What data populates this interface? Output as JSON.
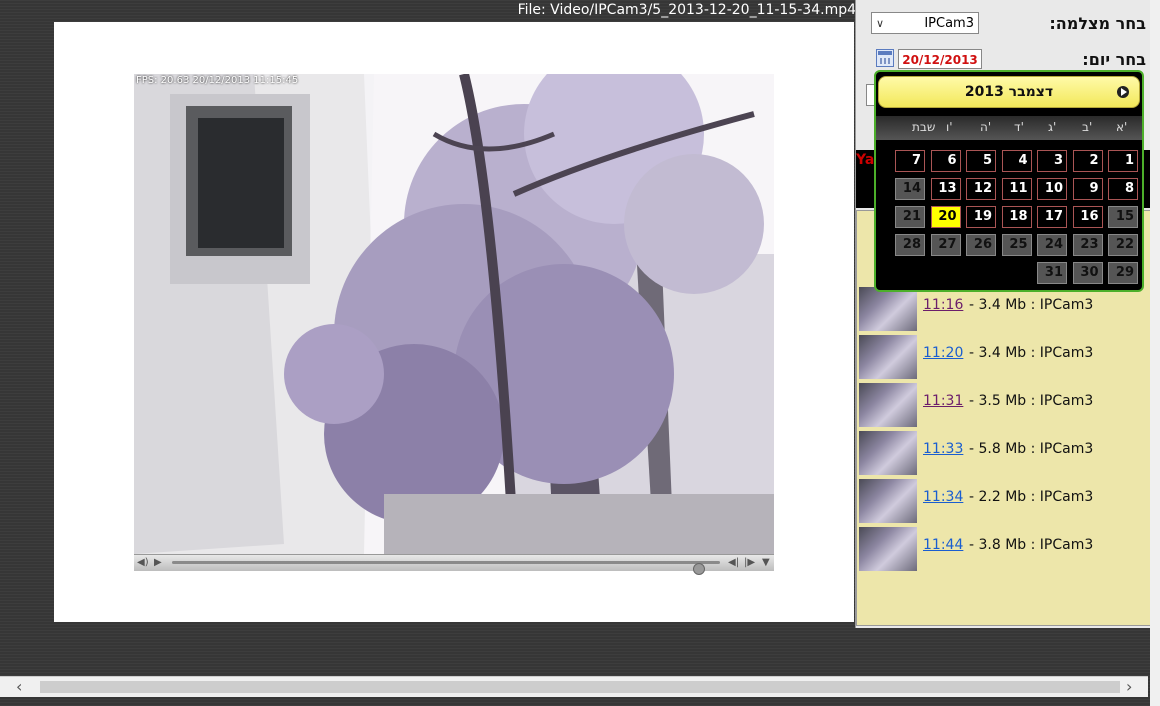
{
  "file_title": "File: Video/IPCam3/5_2013-12-20_11-15-34.mp4",
  "video": {
    "fps_overlay": "FPS: 20.63 20/12/2013 11:15:45",
    "progress": 0.96
  },
  "right_panel": {
    "camera_label": "בחר מצלמה:",
    "camera_value": "IPCam3",
    "date_label": "בחר יום:",
    "date_value": "20/12/2013",
    "side_red_text": "Yai"
  },
  "calendar": {
    "month_title": "דצמבר 2013",
    "weekdays": [
      "א'",
      "ב'",
      "ג'",
      "ד'",
      "ה'",
      "ו'",
      "שבת"
    ],
    "weeks": [
      [
        {
          "d": "1",
          "t": "cur"
        },
        {
          "d": "2",
          "t": "cur"
        },
        {
          "d": "3",
          "t": "cur"
        },
        {
          "d": "4",
          "t": "cur"
        },
        {
          "d": "5",
          "t": "cur"
        },
        {
          "d": "6",
          "t": "cur"
        },
        {
          "d": "7",
          "t": "cur"
        }
      ],
      [
        {
          "d": "8",
          "t": "cur"
        },
        {
          "d": "9",
          "t": "cur"
        },
        {
          "d": "10",
          "t": "cur"
        },
        {
          "d": "11",
          "t": "cur"
        },
        {
          "d": "12",
          "t": "cur"
        },
        {
          "d": "13",
          "t": "cur"
        },
        {
          "d": "14",
          "t": "wknd"
        }
      ],
      [
        {
          "d": "15",
          "t": "wknd"
        },
        {
          "d": "16",
          "t": "cur"
        },
        {
          "d": "17",
          "t": "cur"
        },
        {
          "d": "18",
          "t": "cur"
        },
        {
          "d": "19",
          "t": "cur"
        },
        {
          "d": "20",
          "t": "sel"
        },
        {
          "d": "21",
          "t": "wknd"
        }
      ],
      [
        {
          "d": "22",
          "t": "wknd"
        },
        {
          "d": "23",
          "t": "wknd"
        },
        {
          "d": "24",
          "t": "wknd"
        },
        {
          "d": "25",
          "t": "wknd"
        },
        {
          "d": "26",
          "t": "wknd"
        },
        {
          "d": "27",
          "t": "wknd"
        },
        {
          "d": "28",
          "t": "wknd"
        }
      ],
      [
        {
          "d": "29",
          "t": "wknd"
        },
        {
          "d": "30",
          "t": "wknd"
        },
        {
          "d": "31",
          "t": "wknd"
        }
      ]
    ]
  },
  "recordings": [
    {
      "time": "11:16",
      "info": "- 3.4 Mb : IPCam3",
      "state": "visited"
    },
    {
      "time": "11:20",
      "info": "- 3.4 Mb : IPCam3",
      "state": "fresh"
    },
    {
      "time": "11:31",
      "info": "- 3.5 Mb : IPCam3",
      "state": "visited"
    },
    {
      "time": "11:33",
      "info": "- 5.8 Mb : IPCam3",
      "state": "fresh"
    },
    {
      "time": "11:34",
      "info": "- 2.2 Mb : IPCam3",
      "state": "fresh"
    },
    {
      "time": "11:44",
      "info": "- 3.8 Mb : IPCam3",
      "state": "fresh"
    }
  ],
  "icons": {
    "calendar": "calendar-icon",
    "next_month": "next-month-icon",
    "volume": "volume-icon",
    "play": "play-icon",
    "prev_frame": "prev-frame-icon",
    "next_frame": "next-frame-icon",
    "menu": "menu-icon",
    "scroll_left": "scroll-left-icon",
    "scroll_right": "scroll-right-icon"
  }
}
